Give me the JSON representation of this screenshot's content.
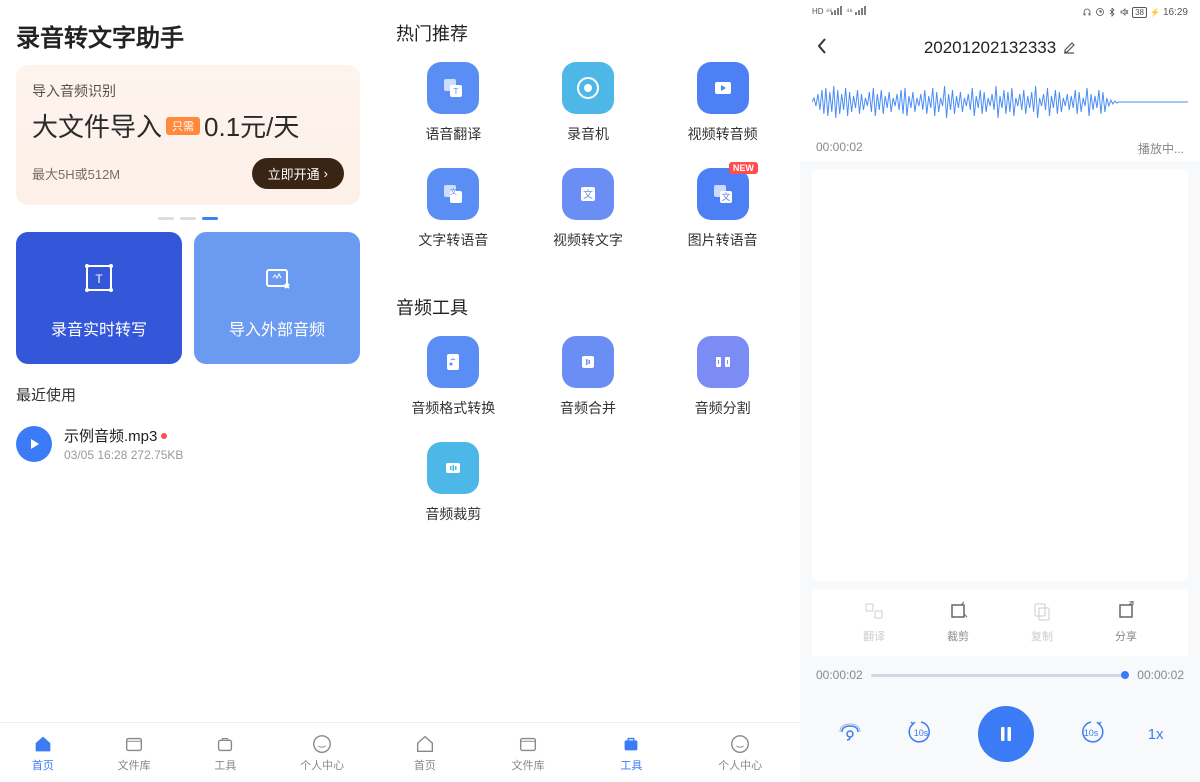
{
  "panel1": {
    "title": "录音转文字助手",
    "promo": {
      "sub": "导入音频识别",
      "big": "大文件导入",
      "tag": "只需",
      "price": "0.1元/天",
      "limit": "最大5H或512M",
      "btn": "立即开通"
    },
    "cards": {
      "record": "录音实时转写",
      "import": "导入外部音频"
    },
    "recent_title": "最近使用",
    "file": {
      "name": "示例音频.mp3",
      "meta": "03/05 16:28   272.75KB"
    },
    "nav": [
      "首页",
      "文件库",
      "工具",
      "个人中心"
    ]
  },
  "panel2": {
    "section1": "热门推荐",
    "section2": "音频工具",
    "hot": [
      "语音翻译",
      "录音机",
      "视频转音频",
      "文字转语音",
      "视频转文字",
      "图片转语音"
    ],
    "new_badge": "NEW",
    "audio": [
      "音频格式转换",
      "音频合并",
      "音频分割",
      "音频裁剪"
    ],
    "nav": [
      "首页",
      "文件库",
      "工具",
      "个人中心"
    ]
  },
  "panel3": {
    "status_time": "16:29",
    "status_battery": "38",
    "title": "20201202132333",
    "time_left": "00:00:02",
    "time_status": "播放中...",
    "actions": [
      "翻译",
      "裁剪",
      "复制",
      "分享"
    ],
    "progress_start": "00:00:02",
    "progress_end": "00:00:02",
    "speed": "1x",
    "skip_back": "10s",
    "skip_fwd": "10s"
  }
}
